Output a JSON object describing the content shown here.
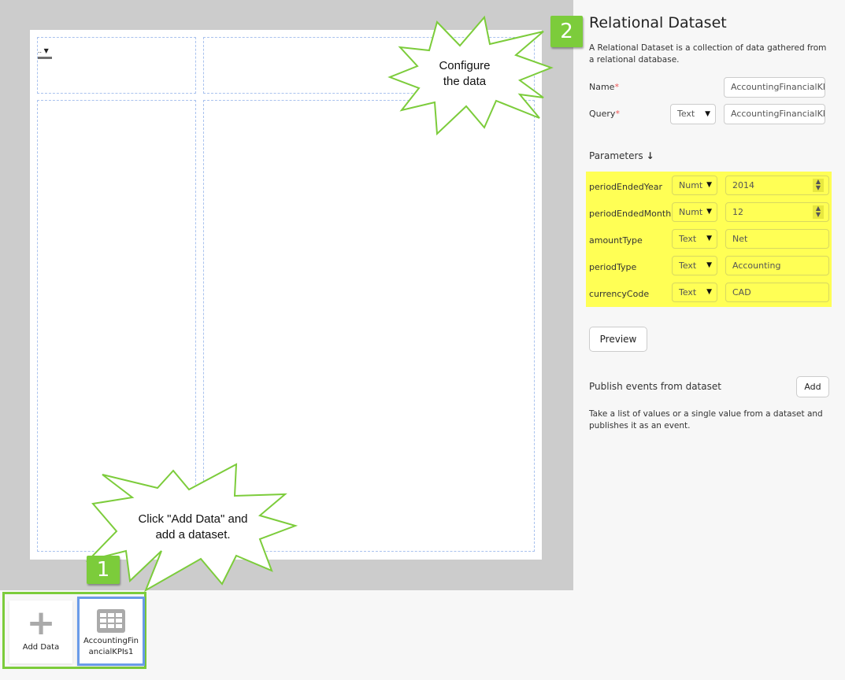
{
  "canvas": {
    "mini_widget_text": "..",
    "cells": 4
  },
  "panel": {
    "title": "Relational Dataset",
    "description": "A Relational Dataset is a collection of data gathered from a relational database.",
    "name_label": "Name",
    "name_value": "AccountingFinancialKP",
    "query_label": "Query",
    "query_type": "Text",
    "query_value": "AccountingFinancialKP",
    "required_mark": "*",
    "parameters_label": "Parameters",
    "parameters": [
      {
        "name": "periodEndedYear",
        "type": "Numt",
        "value": "2014",
        "spinner": true
      },
      {
        "name": "periodEndedMonth",
        "type": "Numt",
        "value": "12",
        "spinner": true
      },
      {
        "name": "amountType",
        "type": "Text",
        "value": "Net"
      },
      {
        "name": "periodType",
        "type": "Text",
        "value": "Accounting"
      },
      {
        "name": "currencyCode",
        "type": "Text",
        "value": "CAD"
      }
    ],
    "preview_label": "Preview",
    "publish_label": "Publish events from dataset",
    "add_label": "Add",
    "publish_desc": "Take a list of values or a single value from a dataset and publishes it as an event."
  },
  "datasets": {
    "add_label": "Add Data",
    "items": [
      {
        "label": "AccountingFinancialKPIs1"
      }
    ]
  },
  "callouts": [
    {
      "badge": "1",
      "text": "Click \"Add Data\" and add a dataset."
    },
    {
      "badge": "2",
      "text": "Configure the data"
    }
  ],
  "colors": {
    "highlight": "#ffff55",
    "accent": "#7ccc3b",
    "selected": "#6a9be8"
  }
}
